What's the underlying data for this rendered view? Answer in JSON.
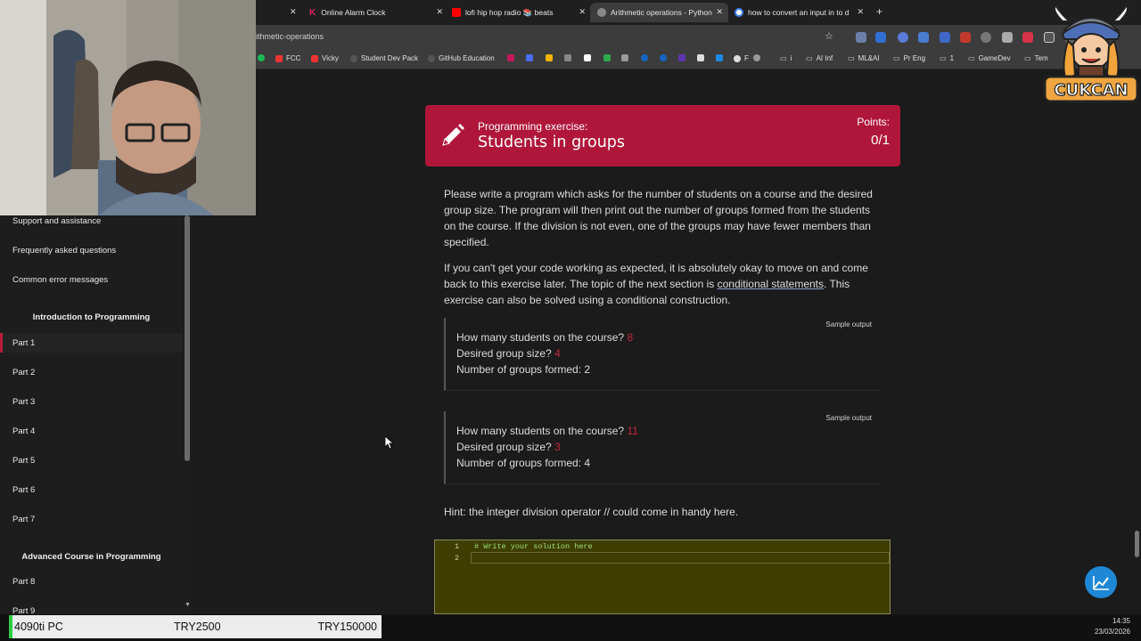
{
  "browser": {
    "tabs": [
      {
        "title": "Online Alarm Clock",
        "favicon_color": "#e0245e"
      },
      {
        "title": "lofi hip hop radio 📚 beats",
        "favicon_color": "#ff0000"
      },
      {
        "title": "Arithmetic operations - Python",
        "favicon_color": "#888888"
      },
      {
        "title": "how to convert an input in to d",
        "favicon_color": "#4285f4"
      }
    ],
    "url": "ithmetic-operations",
    "bookmarks": [
      "FCC",
      "Vicky",
      "Student Dev Pack",
      "GitHub Education",
      "F",
      "i",
      "AI Inf",
      "ML&AI",
      "Pr Eng",
      "1",
      "GameDev",
      "Tem"
    ]
  },
  "sidebar": {
    "items_top": [
      "Support and assistance",
      "Frequently asked questions",
      "Common error messages"
    ],
    "section1": "Introduction to Programming",
    "parts1": [
      "Part 1",
      "Part 2",
      "Part 3",
      "Part 4",
      "Part 5",
      "Part 6",
      "Part 7"
    ],
    "section2": "Advanced Course in Programming",
    "parts2": [
      "Part 8",
      "Part 9"
    ]
  },
  "exercise": {
    "kicker": "Programming exercise:",
    "title": "Students in groups",
    "points_label": "Points:",
    "points_value": "0/1",
    "para1": "Please write a program which asks for the number of students on a course and the desired group size. The program will then print out the number of groups formed from the students on the course. If the division is not even, one of the groups may have fewer members than specified.",
    "para2_a": "If you can't get your code working as expected, it is absolutely okay to move on and come back to this exercise later. The topic of the next section is ",
    "para2_link": "conditional statements",
    "para2_b": ". This exercise can also be solved using a conditional construction.",
    "samples": [
      {
        "label": "Sample output",
        "q1": "How many students on the course? ",
        "a1": "8",
        "q2": "Desired group size? ",
        "a2": "4",
        "result": "Number of groups formed: 2"
      },
      {
        "label": "Sample output",
        "q1": "How many students on the course? ",
        "a1": "11",
        "q2": "Desired group size? ",
        "a2": "3",
        "result": "Number of groups formed: 4"
      }
    ],
    "hint": "Hint: the integer division operator // could come in handy here.",
    "editor": {
      "lines": [
        "1",
        "2"
      ],
      "code": [
        "# Write your solution here",
        ""
      ]
    }
  },
  "logo_text": "CUKCAN",
  "taskbar": {
    "widget_left": "4090ti PC",
    "widget_mid": "TRY2500",
    "widget_right": "TRY150000",
    "time": "14:35",
    "date": "23/03/2026"
  },
  "colors": {
    "accent": "#b0163a",
    "input_value": "#c2273f",
    "fab": "#1e88d6"
  }
}
